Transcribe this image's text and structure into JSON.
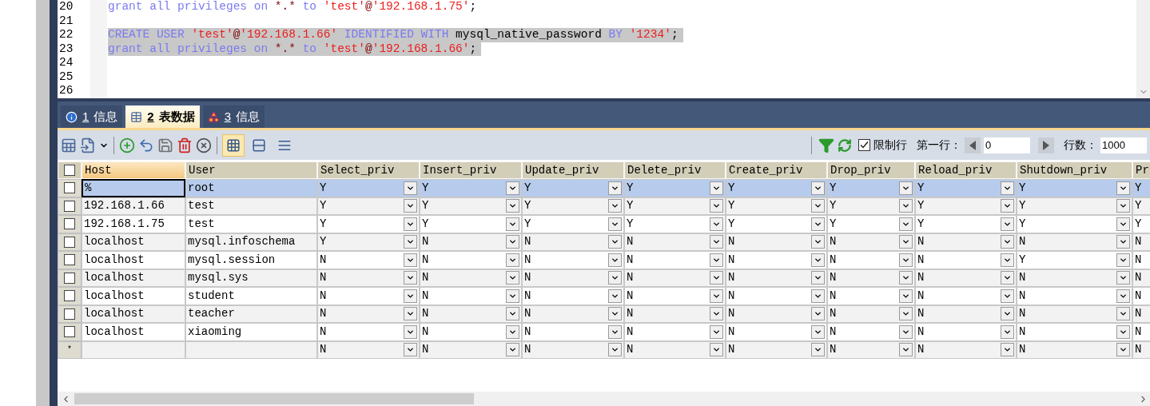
{
  "editor": {
    "lines": [
      {
        "number": "20",
        "selected": false,
        "tokens": [
          {
            "kind": "keyword",
            "text": "grant all privileges on "
          },
          {
            "kind": "op",
            "text": "*.*"
          },
          {
            "kind": "keyword",
            "text": " to "
          },
          {
            "kind": "string",
            "text": "'test'"
          },
          {
            "kind": "op",
            "text": "@"
          },
          {
            "kind": "string",
            "text": "'192.168.1.75'"
          },
          {
            "kind": "plain",
            "text": ";"
          }
        ]
      },
      {
        "number": "21",
        "selected": false
      },
      {
        "number": "22",
        "selected": true,
        "tokens": [
          {
            "kind": "keyword",
            "text": "CREATE USER "
          },
          {
            "kind": "string",
            "text": "'test'"
          },
          {
            "kind": "op",
            "text": "@"
          },
          {
            "kind": "string",
            "text": "'192.168.1.66'"
          },
          {
            "kind": "keyword",
            "text": " IDENTIFIED WITH "
          },
          {
            "kind": "plain",
            "text": "mysql_native_password"
          },
          {
            "kind": "keyword",
            "text": " BY "
          },
          {
            "kind": "string",
            "text": "'1234'"
          },
          {
            "kind": "plain",
            "text": ";"
          }
        ]
      },
      {
        "number": "23",
        "selected": true,
        "tokens": [
          {
            "kind": "keyword",
            "text": "grant all privileges on "
          },
          {
            "kind": "op",
            "text": "*.*"
          },
          {
            "kind": "keyword",
            "text": " to "
          },
          {
            "kind": "string",
            "text": "'test'"
          },
          {
            "kind": "op",
            "text": "@"
          },
          {
            "kind": "string",
            "text": "'192.168.1.66'"
          },
          {
            "kind": "plain",
            "text": ";"
          }
        ]
      },
      {
        "number": "24",
        "selected": false
      },
      {
        "number": "25",
        "selected": false
      },
      {
        "number": "26",
        "selected": false
      }
    ]
  },
  "tabs": [
    {
      "number": "1",
      "label": "信息",
      "kind": "info",
      "selected": false
    },
    {
      "number": "2",
      "label": "表数据",
      "kind": "table",
      "selected": true
    },
    {
      "number": "3",
      "label": "信息",
      "kind": "shapes",
      "selected": false
    }
  ],
  "toolbar": {
    "view_modes": [
      {
        "kind": "grid",
        "selected": true
      },
      {
        "kind": "form",
        "selected": false
      },
      {
        "kind": "text",
        "selected": false
      }
    ],
    "limit_rows": {
      "label": "限制行",
      "checked": true
    },
    "first_row": {
      "label": "第一行：",
      "value": "0"
    },
    "row_count": {
      "label": "行数：",
      "value": "1000"
    }
  },
  "table": {
    "select_all": {
      "checked": false
    },
    "columns": [
      "Host",
      "User",
      "Select_priv",
      "Insert_priv",
      "Update_priv",
      "Delete_priv",
      "Create_priv",
      "Drop_priv",
      "Reload_priv",
      "Shutdown_priv",
      "Pr"
    ],
    "rows": [
      {
        "kind": "data",
        "checked": false,
        "selected": true,
        "host": "%",
        "user": "root",
        "privs": [
          "Y",
          "Y",
          "Y",
          "Y",
          "Y",
          "Y",
          "Y",
          "Y",
          "Y"
        ]
      },
      {
        "kind": "data",
        "checked": false,
        "selected": false,
        "host": "192.168.1.66",
        "user": "test",
        "privs": [
          "Y",
          "Y",
          "Y",
          "Y",
          "Y",
          "Y",
          "Y",
          "Y",
          "Y"
        ]
      },
      {
        "kind": "data",
        "checked": false,
        "selected": false,
        "host": "192.168.1.75",
        "user": "test",
        "privs": [
          "Y",
          "Y",
          "Y",
          "Y",
          "Y",
          "Y",
          "Y",
          "Y",
          "Y"
        ]
      },
      {
        "kind": "data",
        "checked": false,
        "selected": false,
        "host": "localhost",
        "user": "mysql.infoschema",
        "privs": [
          "Y",
          "N",
          "N",
          "N",
          "N",
          "N",
          "N",
          "N",
          "N"
        ]
      },
      {
        "kind": "data",
        "checked": false,
        "selected": false,
        "host": "localhost",
        "user": "mysql.session",
        "privs": [
          "N",
          "N",
          "N",
          "N",
          "N",
          "N",
          "N",
          "Y",
          "N"
        ]
      },
      {
        "kind": "data",
        "checked": false,
        "selected": false,
        "host": "localhost",
        "user": "mysql.sys",
        "privs": [
          "N",
          "N",
          "N",
          "N",
          "N",
          "N",
          "N",
          "N",
          "N"
        ]
      },
      {
        "kind": "data",
        "checked": false,
        "selected": false,
        "host": "localhost",
        "user": "student",
        "privs": [
          "N",
          "N",
          "N",
          "N",
          "N",
          "N",
          "N",
          "N",
          "N"
        ]
      },
      {
        "kind": "data",
        "checked": false,
        "selected": false,
        "host": "localhost",
        "user": "teacher",
        "privs": [
          "N",
          "N",
          "N",
          "N",
          "N",
          "N",
          "N",
          "N",
          "N"
        ]
      },
      {
        "kind": "data",
        "checked": false,
        "selected": false,
        "host": "localhost",
        "user": "xiaoming",
        "privs": [
          "N",
          "N",
          "N",
          "N",
          "N",
          "N",
          "N",
          "N",
          "N"
        ]
      },
      {
        "kind": "new",
        "marker": "*",
        "privs": [
          "N",
          "N",
          "N",
          "N",
          "N",
          "N",
          "N",
          "N",
          "N"
        ]
      }
    ]
  }
}
